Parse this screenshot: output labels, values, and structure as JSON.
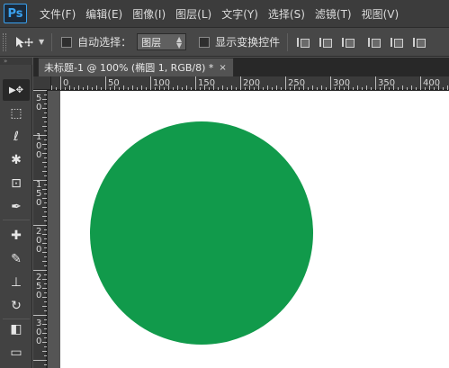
{
  "app": {
    "logo": "Ps",
    "menu": [
      "文件(F)",
      "编辑(E)",
      "图像(I)",
      "图层(L)",
      "文字(Y)",
      "选择(S)",
      "滤镜(T)",
      "视图(V)"
    ]
  },
  "options_bar": {
    "auto_select_label": "自动选择：",
    "auto_select_target": "图层",
    "show_transform_label": "显示变换控件",
    "icons": [
      "move-tool-icon",
      "align-top-icon",
      "align-vcenter-icon",
      "align-bottom-icon",
      "align-left-icon",
      "align-hcenter-icon",
      "align-right-icon"
    ]
  },
  "tools": {
    "header": "»",
    "items": [
      {
        "name": "move-tool-icon",
        "glyph": "▶✥",
        "active": true
      },
      {
        "name": "marquee-tool-icon",
        "glyph": "⬚"
      },
      {
        "name": "lasso-tool-icon",
        "glyph": "ℓ"
      },
      {
        "name": "magic-wand-tool-icon",
        "glyph": "✱"
      },
      {
        "name": "crop-tool-icon",
        "glyph": "⊡"
      },
      {
        "name": "eyedropper-tool-icon",
        "glyph": "✒"
      },
      {
        "name": "healing-brush-tool-icon",
        "glyph": "✚"
      },
      {
        "name": "brush-tool-icon",
        "glyph": "✎"
      },
      {
        "name": "stamp-tool-icon",
        "glyph": "⊥"
      },
      {
        "name": "history-brush-tool-icon",
        "glyph": "↻"
      },
      {
        "name": "eraser-tool-icon",
        "glyph": "◧"
      },
      {
        "name": "gradient-tool-icon",
        "glyph": "▭"
      }
    ]
  },
  "document": {
    "tab_title": "未标题-1 @ 100% (椭圆 1, RGB/8) *",
    "close_glyph": "×",
    "h_ruler_labels": [
      "0",
      "50",
      "100",
      "150",
      "200",
      "250",
      "300",
      "350",
      "400"
    ],
    "v_ruler_labels": [
      "5",
      "0",
      "1",
      "0",
      "0",
      "1",
      "5",
      "0",
      "2",
      "0",
      "0",
      "2",
      "5",
      "0",
      "3",
      "0",
      "0"
    ],
    "canvas_color": "#ffffff",
    "ellipse_color": "#119a4b"
  }
}
